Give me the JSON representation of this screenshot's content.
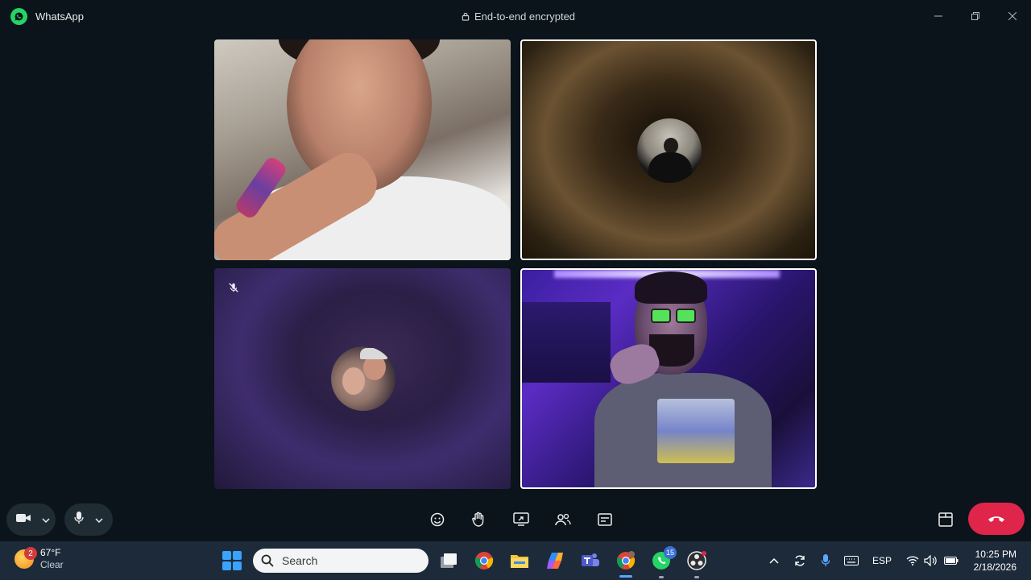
{
  "titlebar": {
    "app_name": "WhatsApp",
    "encryption_text": "End-to-end encrypted",
    "window_controls": [
      "minimize-icon",
      "restore-icon",
      "close-icon"
    ]
  },
  "call": {
    "tiles": [
      {
        "id": "participant-1",
        "type": "video",
        "active": false
      },
      {
        "id": "participant-2",
        "type": "avatar",
        "active": true
      },
      {
        "id": "participant-3",
        "type": "avatar",
        "active": false,
        "muted": true
      },
      {
        "id": "participant-4",
        "type": "video",
        "active": true
      }
    ]
  },
  "controls": {
    "left": [
      "camera-icon",
      "chevron-down-icon",
      "microphone-icon",
      "chevron-down-icon"
    ],
    "center": [
      "emoji-icon",
      "raise-hand-icon",
      "screen-share-icon",
      "participants-icon",
      "captions-icon"
    ],
    "right": [
      "layout-icon",
      "end-call-icon"
    ],
    "end_call_color": "#e0254a"
  },
  "taskbar": {
    "weather": {
      "badge": "2",
      "temp": "67°F",
      "condition": "Clear"
    },
    "search_placeholder": "Search",
    "apps": [
      "windows-start-icon",
      "task-view-icon",
      "chrome-icon",
      "file-explorer-icon",
      "copilot-icon",
      "teams-icon",
      "chrome-profile-icon",
      "whatsapp-icon",
      "obs-icon"
    ],
    "whatsapp_badge": "15",
    "tray": {
      "language": "ESP"
    },
    "clock": {
      "time": "10:25 PM",
      "date": "2/18/2026"
    }
  },
  "colors": {
    "background": "#0b141a",
    "whatsapp_green": "#25d366",
    "control_pill": "#202c33",
    "taskbar": "#1c2a3a"
  }
}
